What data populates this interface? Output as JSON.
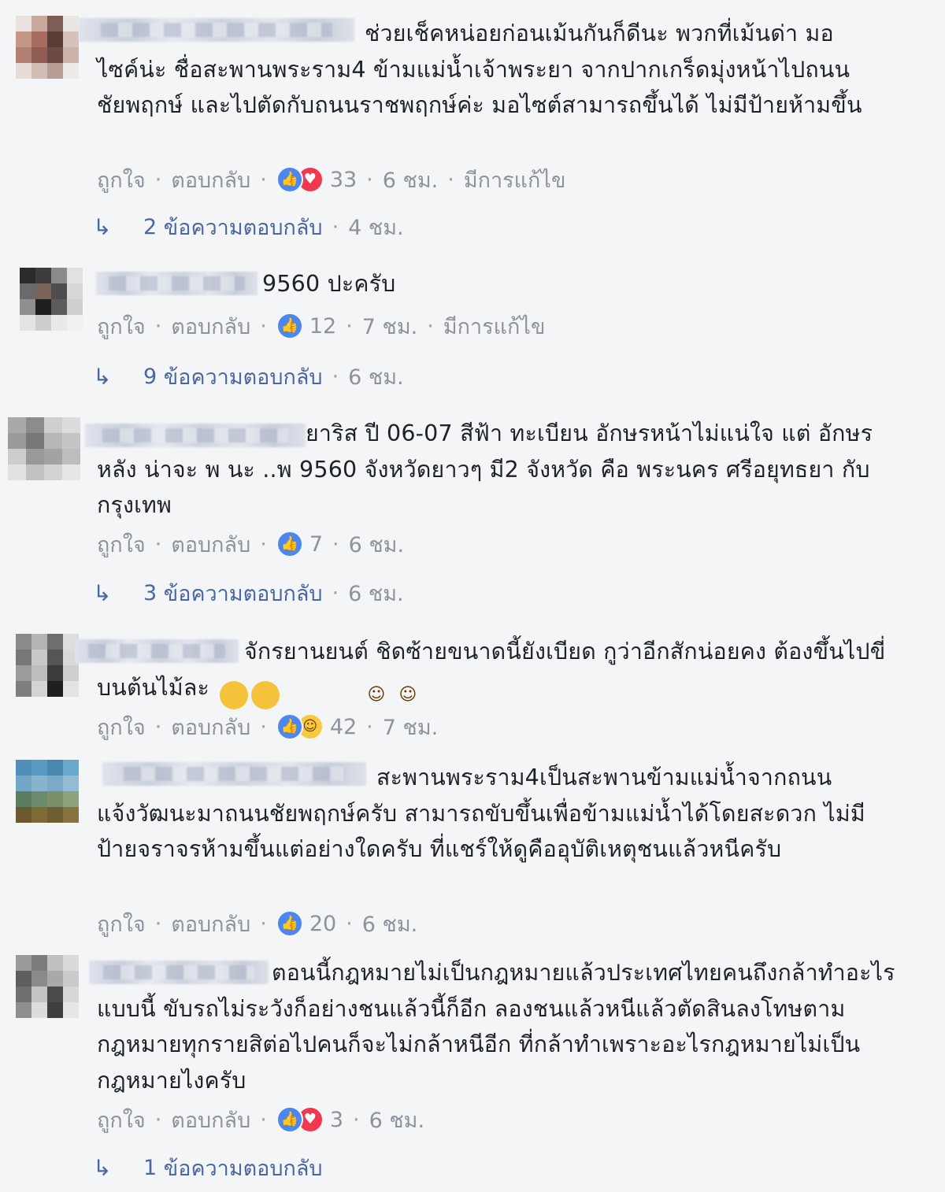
{
  "labels": {
    "like": "ถูกใจ",
    "reply": "ตอบกลับ",
    "separator": "·"
  },
  "comments": [
    {
      "text": "ช่วยเช็คหน่อยก่อนเม้นกันก็ดีนะ พวกที่เม้นด่า มอไซค์น่ะ ชื่อสะพานพระราม4 ข้ามแม่น้ำเจ้าพระยา จากปากเกร็ดมุ่งหน้าไปถนนชัยพฤกษ์ และไปตัดกับถนนราชพฤกษ์ค่ะ มอไซต์สามารถขึ้นได้ ไม่มีป้ายห้ามขึ้น",
      "reactions": [
        "like",
        "love"
      ],
      "count": "33",
      "time": "6 ชม.",
      "edited": "มีการแก้ไข",
      "replies": {
        "count": "2",
        "label": "ข้อความตอบกลับ",
        "time": "4 ชม."
      }
    },
    {
      "text": "9560 ปะครับ",
      "reactions": [
        "like"
      ],
      "count": "12",
      "time": "7 ชม.",
      "edited": "มีการแก้ไข",
      "replies": {
        "count": "9",
        "label": "ข้อความตอบกลับ",
        "time": "6 ชม."
      }
    },
    {
      "text": "ยาริส ปี 06-07 สีฟ้า ทะเบียน อักษรหน้าไม่แน่ใจ แต่ อักษรหลัง น่าจะ พ นะ ..พ 9560 จังหวัดยาวๆ มี2 จังหวัด คือ พระนคร ศรีอยุทธยา กับ กรุงเทพ",
      "reactions": [
        "like"
      ],
      "count": "7",
      "time": "6 ชม.",
      "edited": "",
      "replies": {
        "count": "3",
        "label": "ข้อความตอบกลับ",
        "time": "6 ชม."
      }
    },
    {
      "text": "จักรยานยนต์ ชิดซ้ายขนาดนี้ยังเบียด กูว่าอีกสักน่อยคง ต้องขึ้นไปขี่บนต้นไม้ละ",
      "emojis": [
        "haha",
        "haha"
      ],
      "reactions": [
        "like",
        "haha"
      ],
      "count": "42",
      "time": "7 ชม.",
      "edited": ""
    },
    {
      "text": "สะพานพระราม4เป็นสะพานข้ามแม่น้ำจากถนนแจ้งวัฒนะมาถนนชัยพฤกษ์ครับ สามารถขับขึ้นเพื่อข้ามแม่น้ำได้โดยสะดวก ไม่มีป้ายจราจรห้ามขึ้นแต่อย่างใดครับ ที่แชร์ให้ดูคืออุบัติเหตุชนแล้วหนีครับ",
      "reactions": [
        "like"
      ],
      "count": "20",
      "time": "6 ชม.",
      "edited": ""
    },
    {
      "text": "ตอนนี้กฎหมายไม่เป็นกฎหมายแล้วประเทศไทยคนถึงกล้าทำอะไรแบบนี้ ขับรถไม่ระวังก็อย่างชนแล้วนี้ก็อีก ลองชนแล้วหนีแล้วตัดสินลงโทษตามกฎหมายทุกรายสิต่อไปคนก็จะไม่กล้าหนีอีก ที่กล้าทำเพราะอะไรกฎหมายไม่เป็นกฎหมายไงครับ",
      "reactions": [
        "like",
        "love"
      ],
      "count": "3",
      "time": "6 ชม.",
      "edited": "",
      "replies": {
        "count": "1",
        "label": "ข้อความตอบกลับ",
        "time": ""
      }
    }
  ]
}
